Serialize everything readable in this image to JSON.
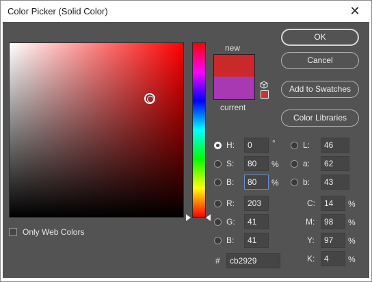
{
  "window": {
    "title": "Color Picker (Solid Color)",
    "close_glyph": "✕"
  },
  "buttons": {
    "ok": "OK",
    "cancel": "Cancel",
    "add_to_swatches": "Add to Swatches",
    "color_libraries": "Color Libraries"
  },
  "preview": {
    "new_label": "new",
    "current_label": "current",
    "new_color": "#cb2929",
    "current_color": "#a73ab3"
  },
  "web_colors": {
    "label": "Only Web Colors",
    "checked": false
  },
  "hsb": {
    "h": {
      "label": "H:",
      "value": "0",
      "unit": "°",
      "selected": true
    },
    "s": {
      "label": "S:",
      "value": "80",
      "unit": "%",
      "selected": false
    },
    "b": {
      "label": "B:",
      "value": "80",
      "unit": "%",
      "selected": false
    }
  },
  "rgb": {
    "r": {
      "label": "R:",
      "value": "203"
    },
    "g": {
      "label": "G:",
      "value": "41"
    },
    "b": {
      "label": "B:",
      "value": "41"
    }
  },
  "lab": {
    "l": {
      "label": "L:",
      "value": "46"
    },
    "a": {
      "label": "a:",
      "value": "62"
    },
    "b": {
      "label": "b:",
      "value": "43"
    }
  },
  "cmyk": {
    "c": {
      "label": "C:",
      "value": "14",
      "unit": "%"
    },
    "m": {
      "label": "M:",
      "value": "98",
      "unit": "%"
    },
    "y": {
      "label": "Y:",
      "value": "97",
      "unit": "%"
    },
    "k": {
      "label": "K:",
      "value": "4",
      "unit": "%"
    }
  },
  "hex": {
    "label": "#",
    "value": "cb2929"
  },
  "icons": {
    "websafe_cube": "cube-icon",
    "websafe_swatch_color": "#cc3333"
  }
}
